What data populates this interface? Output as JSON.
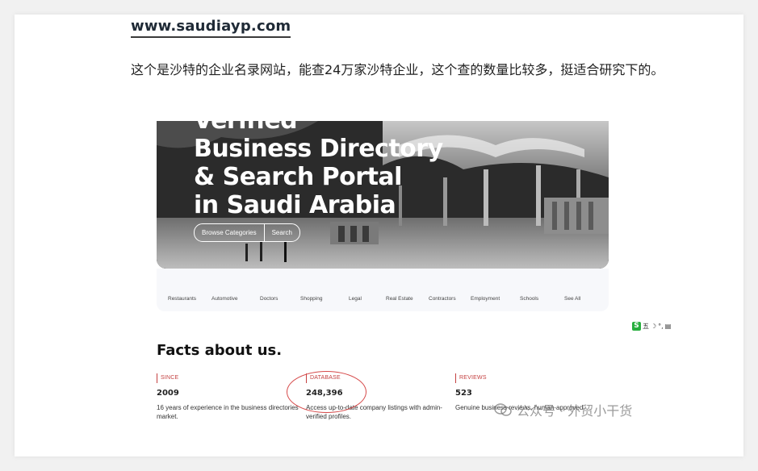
{
  "article": {
    "site_link": "www.saudiayp.com",
    "description": "这个是沙特的企业名录网站，能查24万家沙特企业，这个查的数量比较多，挺适合研究下的。"
  },
  "screenshot": {
    "hero": {
      "title_lines": [
        "Verified",
        "Business Directory",
        "& Search Portal",
        "in Saudi Arabia"
      ],
      "browse_button": "Browse Categories",
      "search_button": "Search"
    },
    "categories": [
      "Restaurants",
      "Automotive",
      "Doctors",
      "Shopping",
      "Legal",
      "Real Estate",
      "Contractors",
      "Employment",
      "Schools",
      "See All"
    ],
    "toolbar_text": "五",
    "facts_title": "Facts about us.",
    "facts": [
      {
        "label": "SINCE",
        "value": "2009",
        "text": "16 years of experience in the business directories market."
      },
      {
        "label": "DATABASE",
        "value": "248,396",
        "text": "Access up-to-date company listings with admin-verified profiles."
      },
      {
        "label": "REVIEWS",
        "value": "523",
        "text": "Genuine business reviews, human-approved."
      }
    ]
  },
  "watermark": {
    "text": "公众号 · 外贸小干货",
    "icon": "wechat-official-account-icon"
  },
  "colors": {
    "accent_red": "#c44040",
    "circle_red": "#d64a4a",
    "toolbar_green": "#27ae3e"
  }
}
